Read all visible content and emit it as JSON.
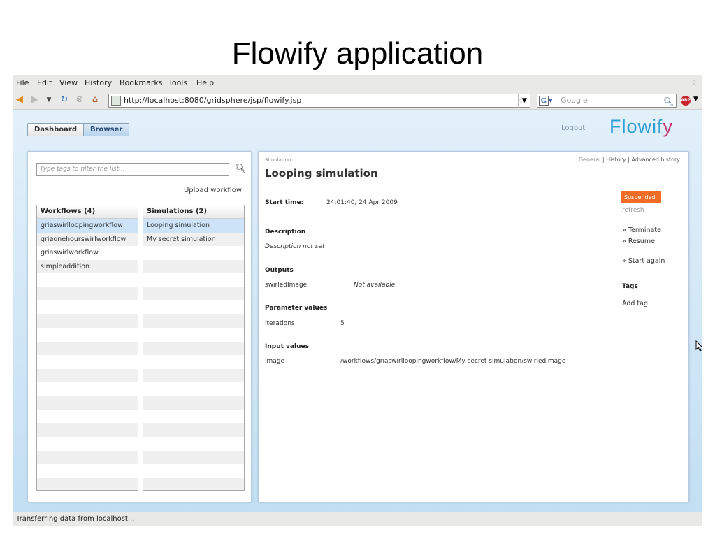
{
  "slide": {
    "title": "Flowify application"
  },
  "browser": {
    "menu": [
      "File",
      "Edit",
      "View",
      "History",
      "Bookmarks",
      "Tools",
      "Help"
    ],
    "url": "http://localhost:8080/gridsphere/jsp/flowify.jsp",
    "search_placeholder": "Google",
    "status": "Transferring data from localhost..."
  },
  "app": {
    "tabs": [
      "Dashboard",
      "Browser"
    ],
    "active_tab": "Browser",
    "logout": "Logout",
    "logo": {
      "main": "Flowif",
      "accent": "y"
    },
    "accent_colors": {
      "logo_blue": "#2f9fd4",
      "logo_pink": "#c8316b",
      "suspended_orange": "#f06c27"
    },
    "left": {
      "filter_placeholder": "Type tags to filter the list...",
      "upload_label": "Upload workflow",
      "workflows": {
        "header": "Workflows (4)",
        "items": [
          "griaswirlloopingworkflow",
          "griaonehourswirlworkflow",
          "griaswirlworkflow",
          "simpleaddition"
        ],
        "selected_index": 0
      },
      "simulations": {
        "header": "Simulations (2)",
        "items": [
          "Looping simulation",
          "My secret simulation"
        ],
        "selected_index": 0
      }
    },
    "simulation": {
      "small_label": "Simulation",
      "title": "Looping simulation",
      "links": {
        "general": "General",
        "history": "History",
        "advanced": "Advanced history",
        "sep": "|"
      },
      "start_time_label": "Start time:",
      "start_time": "24:01:40, 24 Apr 2009",
      "description_label": "Description",
      "description": "Description not set",
      "outputs_label": "Outputs",
      "outputs": [
        {
          "name": "swirledImage",
          "value": "Not available"
        }
      ],
      "parameters_label": "Parameter values",
      "parameters": [
        {
          "name": "iterations",
          "value": "5"
        }
      ],
      "inputs_label": "Input values",
      "inputs": [
        {
          "name": "image",
          "value": "/workflows/griaswirlloopingworkflow/My secret simulation/swirledImage"
        }
      ],
      "status": "Suspended",
      "refresh": "refresh",
      "actions": {
        "terminate": "» Terminate",
        "resume": "» Resume",
        "start_again": "» Start again"
      },
      "tags_label": "Tags",
      "add_tag": "Add tag"
    }
  }
}
